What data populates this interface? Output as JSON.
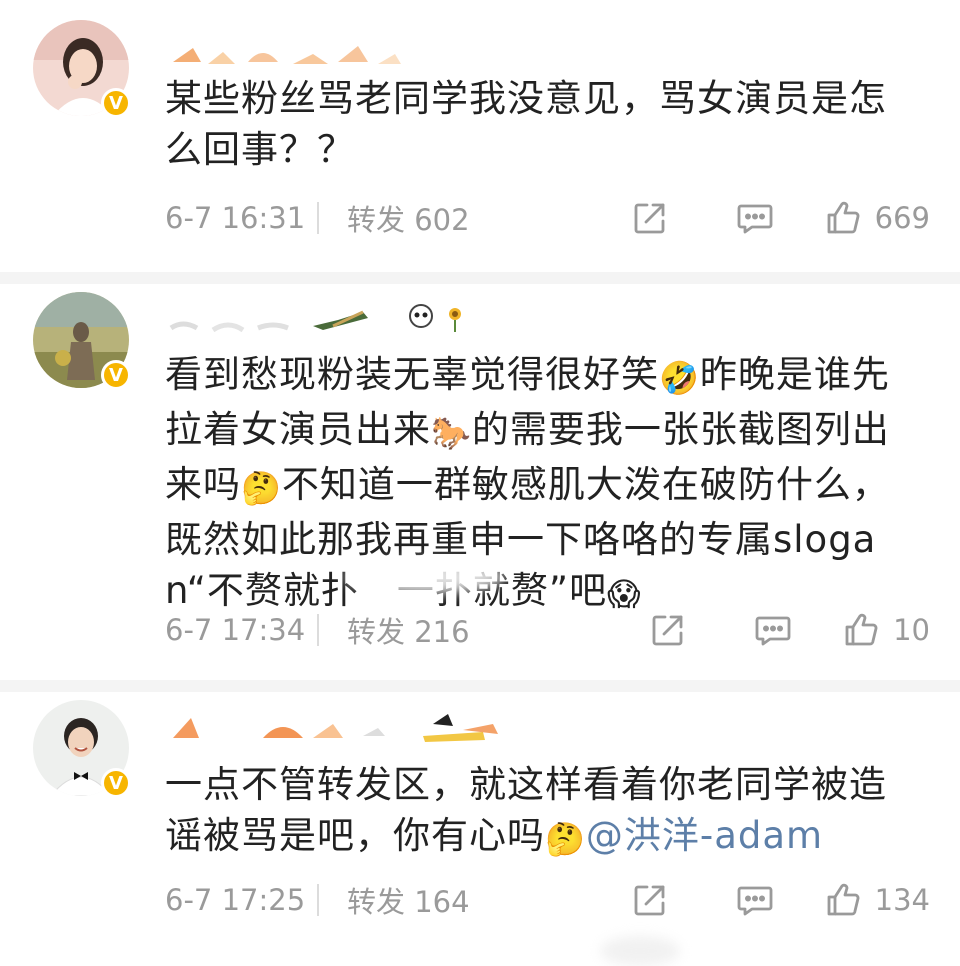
{
  "posts": [
    {
      "text": "某些粉丝骂老同学我没意见，骂女演员是怎么回事？？",
      "time": "6-7 16:31",
      "forward_label": "转发 602",
      "like_count": "669"
    },
    {
      "text_parts": [
        "看到愁现粉装无辜觉得很好笑",
        "昨晚是谁先拉着女演员出来",
        "的需要我一张张截图列出来吗",
        "不知道一群敏感肌大泼在破防什么，既然如此那我再重申一下咯咯的专属slogan“不赘就扑　一扑就赘”吧"
      ],
      "emojis": [
        "🤣",
        "🐎",
        "🤔",
        "😱"
      ],
      "time": "6-7 17:34",
      "forward_label": "转发 216",
      "like_count": "10"
    },
    {
      "text": "一点不管转发区，就这样看着你老同学被造谣被骂是吧，你有心吗",
      "emoji": "🤔",
      "mention": "@洪洋-adam",
      "time": "6-7 17:25",
      "forward_label": "转发 164",
      "like_count": "134"
    }
  ],
  "icons": {
    "share": "share-icon",
    "comment": "comment-icon",
    "like": "thumbs-up-icon",
    "verified": "verified-badge-icon"
  },
  "colors": {
    "text": "#222222",
    "meta": "#9a9a9a",
    "mention": "#5d7fa8",
    "verified": "#f7b500"
  }
}
